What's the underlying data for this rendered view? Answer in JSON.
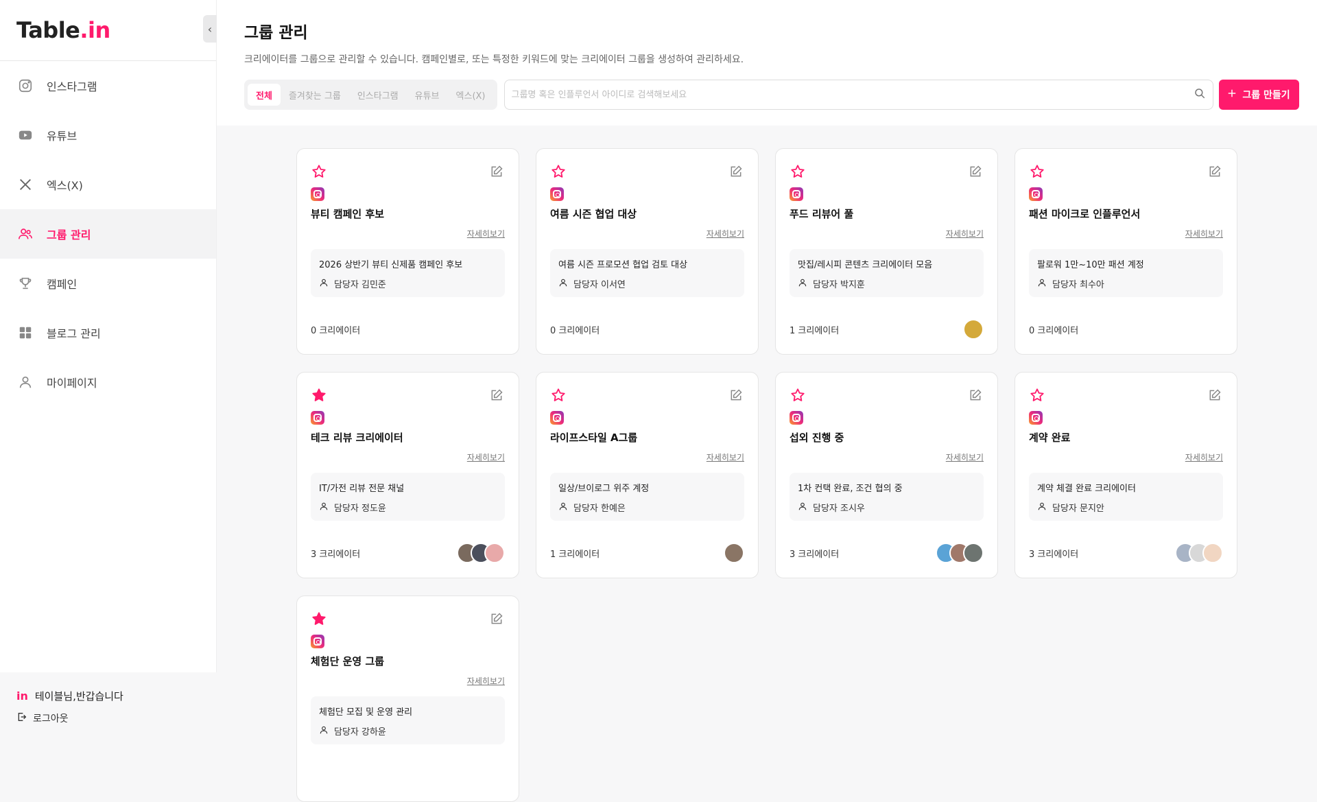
{
  "app": {
    "logo_main": "Table",
    "logo_dot": ".",
    "logo_in": "in"
  },
  "sidebar": {
    "items": [
      {
        "label": "인스타그램",
        "icon": "instagram-icon"
      },
      {
        "label": "유튜브",
        "icon": "youtube-icon"
      },
      {
        "label": "엑스(X)",
        "icon": "x-icon"
      },
      {
        "label": "그룹 관리",
        "icon": "users-icon",
        "active": true
      },
      {
        "label": "캠페인",
        "icon": "trophy-icon"
      },
      {
        "label": "블로그 관리",
        "icon": "grid-icon"
      },
      {
        "label": "마이페이지",
        "icon": "user-icon"
      }
    ],
    "footer": {
      "logo": "in",
      "welcome": "테이블님,반갑습니다",
      "logout": "로그아웃"
    }
  },
  "header": {
    "title": "그룹 관리",
    "description": "크리에이터를 그룹으로 관리할 수 있습니다. 캠페인별로, 또는 특정한 키워드에 맞는 크리에이터 그룹을 생성하여 관리하세요.",
    "tabs": [
      "전체",
      "즐겨찾는 그룹",
      "인스타그램",
      "유튜브",
      "엑스(X)"
    ],
    "search_placeholder": "그룹명 혹은 인플루언서 아이디로 검색해보세요",
    "create_label": "그룹 만들기"
  },
  "colors": {
    "accent": "#ff1a6c"
  },
  "cards": [
    {
      "title": "뷰티 캠페인 후보",
      "detail": "자세히보기",
      "desc": "2026 상반기 뷰티 신제품 캠페인 후보",
      "manager": "담당자 김민준",
      "count": "0 크리에이터",
      "favorite": false,
      "avatars": []
    },
    {
      "title": "여름 시즌 협업 대상",
      "detail": "자세히보기",
      "desc": "여름 시즌 프로모션 협업 검토 대상",
      "manager": "담당자 이서연",
      "count": "0 크리에이터",
      "favorite": false,
      "avatars": []
    },
    {
      "title": "푸드 리뷰어 풀",
      "detail": "자세히보기",
      "desc": "맛집/레시피 콘텐츠 크리에이터 모음",
      "manager": "담당자 박지훈",
      "count": "1 크리에이터",
      "favorite": false,
      "avatars": [
        "#d4a93a"
      ]
    },
    {
      "title": "패션 마이크로 인플루언서",
      "detail": "자세히보기",
      "desc": "팔로워 1만~10만 패션 계정",
      "manager": "담당자 최수아",
      "count": "0 크리에이터",
      "favorite": false,
      "avatars": []
    },
    {
      "title": "테크 리뷰 크리에이터",
      "detail": "자세히보기",
      "desc": "IT/가전 리뷰 전문 채널",
      "manager": "담당자 정도윤",
      "count": "3 크리에이터",
      "favorite": true,
      "avatars": [
        "#7a6a5e",
        "#4b4f5c",
        "#e8a9a9"
      ]
    },
    {
      "title": "라이프스타일 A그룹",
      "detail": "자세히보기",
      "desc": "일상/브이로그 위주 계정",
      "manager": "담당자 한예은",
      "count": "1 크리에이터",
      "favorite": false,
      "avatars": [
        "#8a7565"
      ]
    },
    {
      "title": "섭외 진행 중",
      "detail": "자세히보기",
      "desc": "1차 컨택 완료, 조건 협의 중",
      "manager": "담당자 조시우",
      "count": "3 크리에이터",
      "favorite": false,
      "avatars": [
        "#5aa3d6",
        "#a0786a",
        "#6d7470"
      ]
    },
    {
      "title": "계약 완료",
      "detail": "자세히보기",
      "desc": "계약 체결 완료 크리에이터",
      "manager": "담당자 문지안",
      "count": "3 크리에이터",
      "favorite": false,
      "avatars": [
        "#a8b4c6",
        "#d8d8d8",
        "#f1d6c2"
      ]
    },
    {
      "title": "체험단 운영 그룹",
      "detail": "자세히보기",
      "desc": "체험단 모집 및 운영 관리",
      "manager": "담당자 강하윤",
      "count": "",
      "favorite": true,
      "avatars": []
    }
  ]
}
